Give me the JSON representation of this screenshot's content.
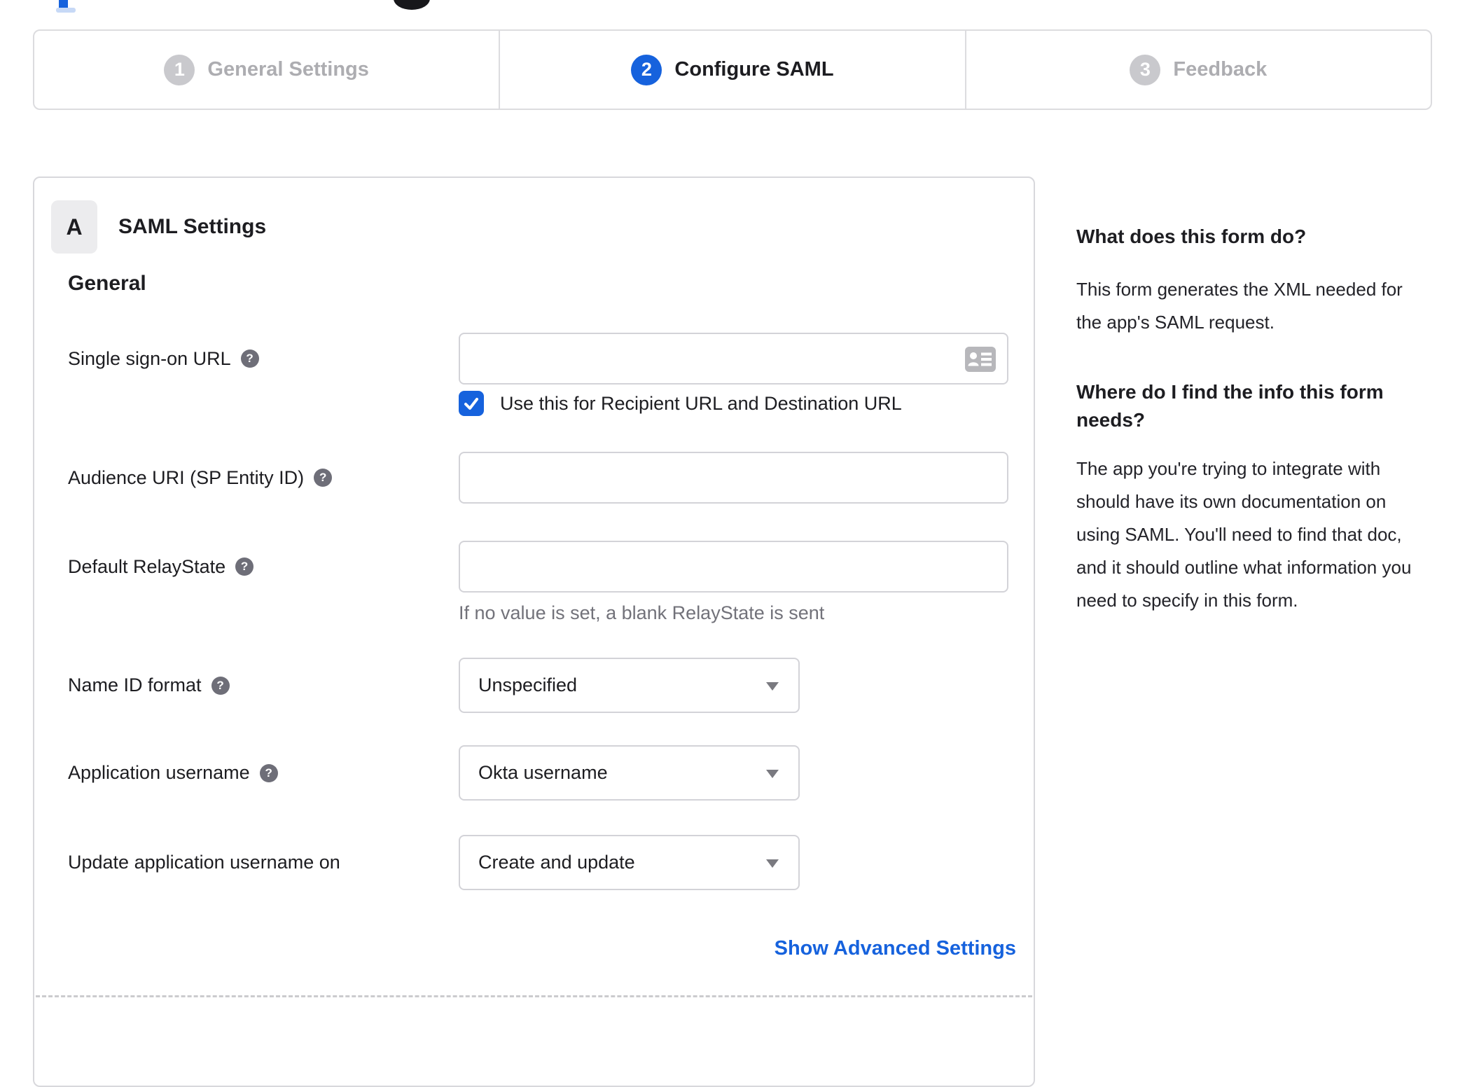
{
  "colors": {
    "accent": "#1662dd",
    "border": "#d8d8dc",
    "muted_text": "#72727a"
  },
  "stepper": {
    "steps": [
      {
        "number": "1",
        "label": "General Settings",
        "state": "inactive"
      },
      {
        "number": "2",
        "label": "Configure SAML",
        "state": "active"
      },
      {
        "number": "3",
        "label": "Feedback",
        "state": "inactive"
      }
    ]
  },
  "panel": {
    "badge": "A",
    "title": "SAML Settings",
    "section_heading": "General",
    "fields": [
      {
        "label": "Single sign-on URL",
        "has_help": true,
        "type": "text",
        "value": "",
        "checkbox_checked": true,
        "checkbox_label": "Use this for Recipient URL and Destination URL",
        "trailing_icon": "contact-card-icon"
      },
      {
        "label": "Audience URI (SP Entity ID)",
        "has_help": true,
        "type": "text",
        "value": ""
      },
      {
        "label": "Default RelayState",
        "has_help": true,
        "type": "text",
        "value": "",
        "hint": "If no value is set, a blank RelayState is sent"
      },
      {
        "label": "Name ID format",
        "has_help": true,
        "type": "select",
        "value": "Unspecified"
      },
      {
        "label": "Application username",
        "has_help": true,
        "type": "select",
        "value": "Okta username"
      },
      {
        "label": "Update application username on",
        "has_help": false,
        "type": "select",
        "value": "Create and update"
      }
    ],
    "advanced_link": "Show Advanced Settings"
  },
  "sidebar": {
    "sections": [
      {
        "heading": "What does this form do?",
        "body": "This form generates the XML needed for the app's SAML request."
      },
      {
        "heading": "Where do I find the info this form needs?",
        "body": "The app you're trying to integrate with should have its own documentation on using SAML. You'll need to find that doc, and it should outline what information you need to specify in this form."
      }
    ]
  }
}
